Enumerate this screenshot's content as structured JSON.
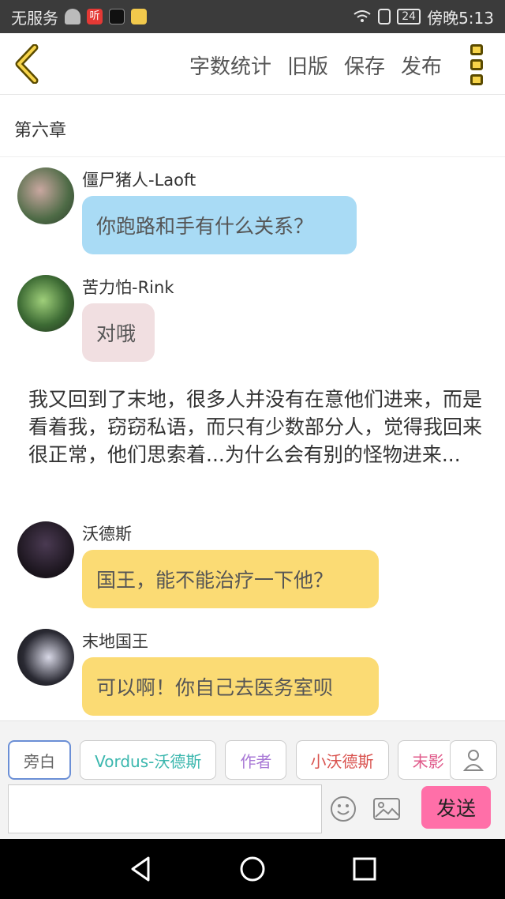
{
  "status_bar": {
    "carrier": "无服务",
    "notif_listen": "听",
    "battery": "24",
    "time": "傍晚5:13"
  },
  "top_bar": {
    "actions": [
      "字数统计",
      "旧版",
      "保存",
      "发布"
    ]
  },
  "chapter_title": "第六章",
  "messages": [
    {
      "name": "僵尸猪人-Laoft",
      "text": "你跑路和手有什么关系？",
      "color": "#a9dbf5"
    },
    {
      "name": "苦力怕-Rink",
      "text": "对哦",
      "color": "#f1dfe1"
    },
    {
      "name": "沃德斯",
      "text": "国王，能不能治疗一下他？",
      "color": "#fbdb74"
    },
    {
      "name": "末地国王",
      "text": "可以啊！你自己去医务室呗",
      "color": "#fbdb74"
    }
  ],
  "narration": "我又回到了末地，很多人并没有在意他们进来，而是看着我，窃窃私语，而只有少数部分人，觉得我回来很正常，他们思索着...为什么会有别的怪物进来...",
  "role_chips": [
    {
      "label": "旁白",
      "color": "#666666"
    },
    {
      "label": "Vordus-沃德斯",
      "color": "#3bb7ae"
    },
    {
      "label": "作者",
      "color": "#a878d6"
    },
    {
      "label": "小沃德斯",
      "color": "#d9534f"
    },
    {
      "label": "末影",
      "color": "#e05a8a"
    }
  ],
  "input": {
    "placeholder": ""
  },
  "send_label": "发送",
  "colors": {
    "accent_yellow": "#f7d44a",
    "send_pink": "#ff6fa8"
  }
}
